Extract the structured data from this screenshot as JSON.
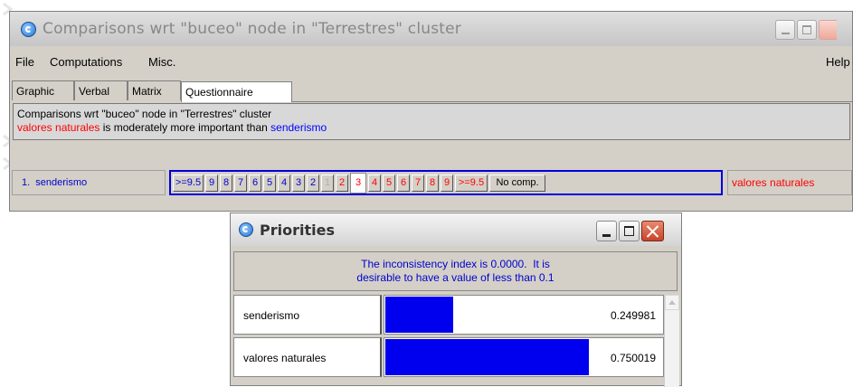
{
  "main_window": {
    "title": "Comparisons wrt \"buceo\" node in \"Terrestres\" cluster",
    "menu": [
      "File",
      "Computations",
      "Misc.",
      "Help"
    ],
    "tabs": [
      "Graphic",
      "Verbal",
      "Matrix",
      "Questionnaire"
    ],
    "active_tab": "Questionnaire",
    "description": {
      "line1": "Comparisons wrt \"buceo\" node in \"Terrestres\" cluster",
      "line2_red": "valores naturales",
      "line2_mid": " is moderately more important than ",
      "line2_blue": "senderismo"
    },
    "questionnaire": {
      "left_label": "1.  senderismo",
      "scale": [
        ">=9.5",
        "9",
        "8",
        "7",
        "6",
        "5",
        "4",
        "3",
        "2",
        "1",
        "2",
        "3",
        "4",
        "5",
        "6",
        "7",
        "8",
        "9",
        ">=9.5"
      ],
      "selected": "3",
      "no_comp": "No comp.",
      "right_label": "valores naturales"
    }
  },
  "priorities_window": {
    "title": "Priorities",
    "inconsistency_line1": "The inconsistency index is 0.0000.  It is",
    "inconsistency_line2": "desirable to have a value of less than 0.1",
    "rows": [
      {
        "name": "senderismo",
        "value": "0.249981",
        "weight": 0.249981
      },
      {
        "name": "valores naturales",
        "value": "0.750019",
        "weight": 0.750019
      }
    ],
    "bar_color": "#0000ee"
  }
}
